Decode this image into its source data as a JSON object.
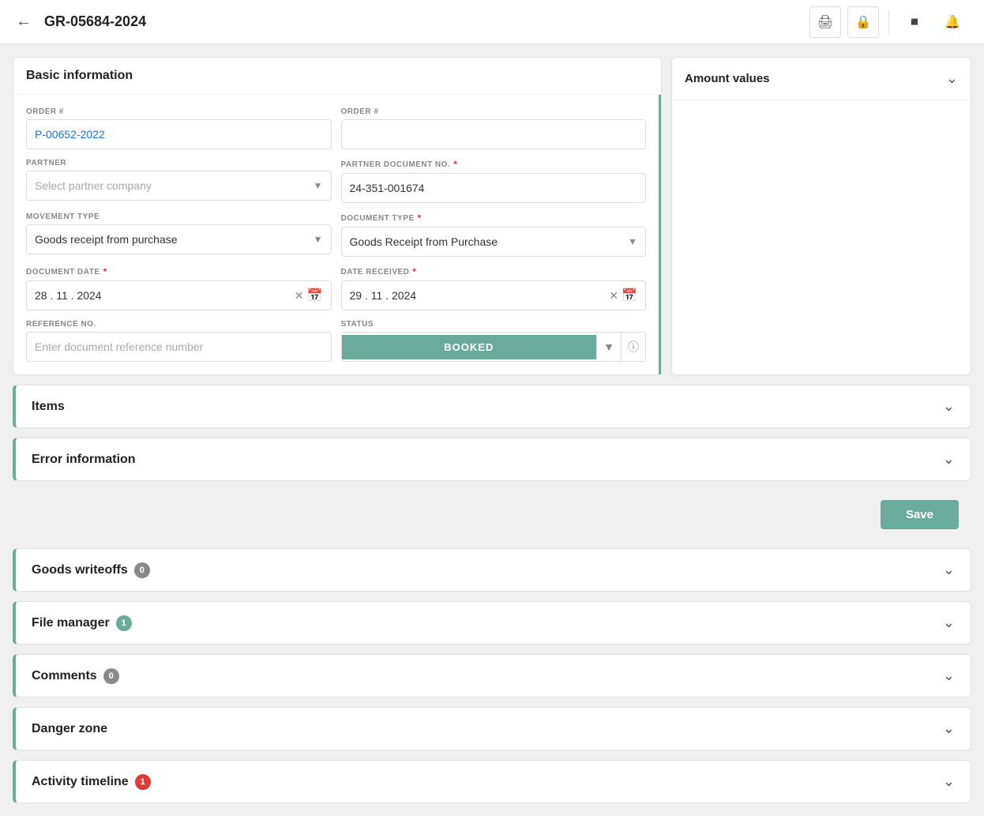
{
  "header": {
    "title": "GR-05684-2024",
    "back_icon": "←",
    "print_icon": "🖨",
    "lock_icon": "🔒",
    "apps_icon": "⊞",
    "bell_icon": "🔔"
  },
  "basic_info": {
    "title": "Basic information",
    "order_1_label": "ORDER #",
    "order_1_value": "P-00652-2022",
    "order_2_label": "ORDER #",
    "order_2_value": "",
    "partner_label": "PARTNER",
    "partner_placeholder": "Select partner company",
    "partner_doc_label": "PARTNER DOCUMENT NO.",
    "partner_doc_value": "24-351-001674",
    "movement_type_label": "MOVEMENT TYPE",
    "movement_type_value": "Goods receipt from purchase",
    "document_type_label": "DOCUMENT TYPE",
    "document_type_value": "Goods Receipt from Purchase",
    "document_date_label": "DOCUMENT DATE",
    "document_date_value": "28 . 11 . 2024",
    "date_received_label": "DATE RECEIVED",
    "date_received_value": "29 . 11 . 2024",
    "reference_no_label": "REFERENCE NO.",
    "reference_no_placeholder": "Enter document reference number",
    "status_label": "STATUS",
    "status_value": "BOOKED"
  },
  "amount_values": {
    "title": "Amount values"
  },
  "items": {
    "title": "Items"
  },
  "error_info": {
    "title": "Error information"
  },
  "actions": {
    "save_label": "Save"
  },
  "goods_writeoffs": {
    "title": "Goods writeoffs",
    "count": "0"
  },
  "file_manager": {
    "title": "File manager",
    "count": "1"
  },
  "comments": {
    "title": "Comments",
    "count": "0"
  },
  "danger_zone": {
    "title": "Danger zone"
  },
  "activity_timeline": {
    "title": "Activity timeline",
    "count": "1"
  },
  "colors": {
    "accent": "#6aab9c",
    "danger": "#e53935",
    "link": "#1a73e8"
  }
}
